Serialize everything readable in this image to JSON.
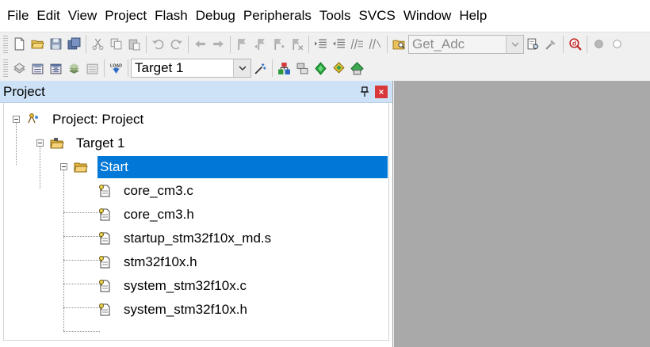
{
  "menu": [
    "File",
    "Edit",
    "View",
    "Project",
    "Flash",
    "Debug",
    "Peripherals",
    "Tools",
    "SVCS",
    "Window",
    "Help"
  ],
  "toolbar1": {
    "find_combo_value": "Get_Adc"
  },
  "toolbar2": {
    "target_combo_value": "Target 1"
  },
  "project_panel": {
    "title": "Project",
    "tree": {
      "root": "Project: Project",
      "target": "Target 1",
      "group": "Start",
      "files": [
        "core_cm3.c",
        "core_cm3.h",
        "startup_stm32f10x_md.s",
        "stm32f10x.h",
        "system_stm32f10x.c",
        "system_stm32f10x.h"
      ]
    }
  },
  "colors": {
    "selection": "#0078d7",
    "panel_header": "#cde2f6",
    "editor_background": "#a9a9a9",
    "close_button": "#d9383a"
  }
}
